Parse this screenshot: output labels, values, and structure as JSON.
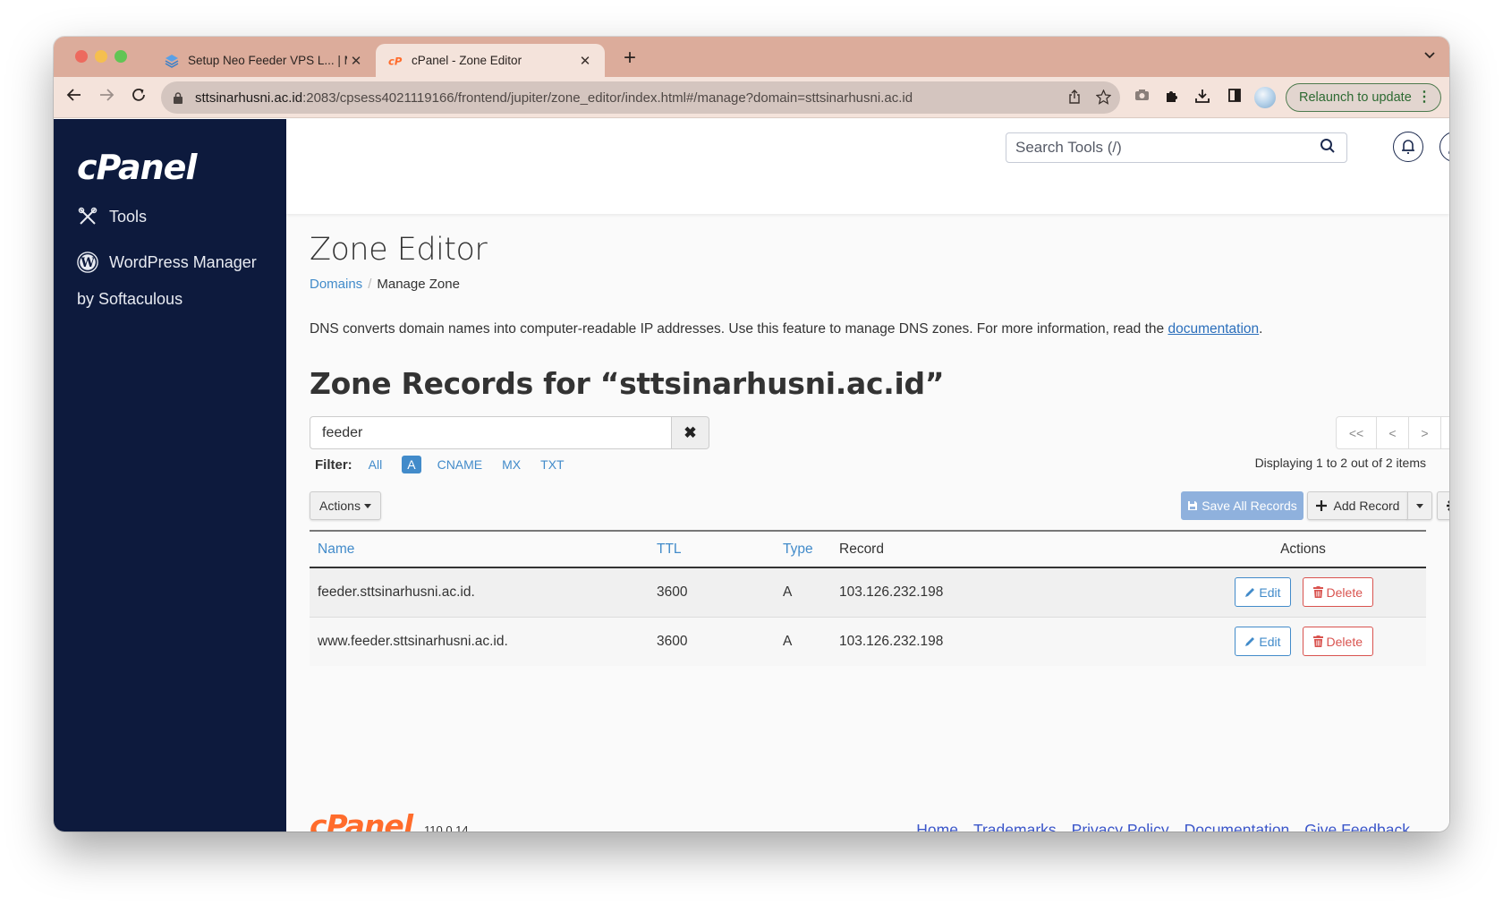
{
  "browser": {
    "tabs": [
      {
        "title": "Setup Neo Feeder VPS L... | M",
        "favicon": "stack-icon",
        "active": false
      },
      {
        "title": "cPanel - Zone Editor",
        "favicon": "cpanel-icon",
        "active": true
      }
    ],
    "new_tab_label": "+",
    "tab_close_glyph": "✕",
    "address": {
      "host": "sttsinarhusni.ac.id",
      "path": ":2083/cpsess4021119166/frontend/jupiter/zone_editor/index.html#/manage?domain=sttsinarhusni.ac.id"
    },
    "relaunch_label": "Relaunch to update"
  },
  "sidebar": {
    "logo": "cPanel",
    "items": [
      {
        "label": "Tools",
        "icon": "tools-icon"
      },
      {
        "label": "WordPress Manager",
        "sublabel": "by Softaculous",
        "icon": "wordpress-icon"
      }
    ]
  },
  "header": {
    "search_placeholder": "Search Tools (/)"
  },
  "page": {
    "title": "Zone Editor",
    "breadcrumb": [
      {
        "label": "Domains",
        "link": true
      },
      {
        "label": "Manage Zone",
        "link": false
      }
    ],
    "intro_text": "DNS converts domain names into computer-readable IP addresses. Use this feature to manage DNS zones. For more information, read the ",
    "intro_link": "documentation",
    "intro_end": ".",
    "zone_title": "Zone Records for “sttsinarhusni.ac.id”"
  },
  "records_search": {
    "value": "feeder",
    "clear_glyph": "✖"
  },
  "filter": {
    "label": "Filter:",
    "options": [
      {
        "label": "All",
        "active": false
      },
      {
        "label": "A",
        "active": true
      },
      {
        "label": "CNAME",
        "active": false
      },
      {
        "label": "MX",
        "active": false
      },
      {
        "label": "TXT",
        "active": false
      }
    ]
  },
  "pagination": {
    "first": "<<",
    "prev": "<",
    "next": ">",
    "last": ">>",
    "summary": "Displaying 1 to 2 out of 2 items"
  },
  "toolbar": {
    "actions_label": "Actions",
    "save_all_label": "Save All Records",
    "add_record_label": "Add Record"
  },
  "table": {
    "columns": [
      "Name",
      "TTL",
      "Type",
      "Record",
      "Actions"
    ],
    "rows": [
      {
        "name": "feeder.sttsinarhusni.ac.id.",
        "ttl": "3600",
        "type": "A",
        "record": "103.126.232.198"
      },
      {
        "name": "www.feeder.sttsinarhusni.ac.id.",
        "ttl": "3600",
        "type": "A",
        "record": "103.126.232.198"
      }
    ],
    "edit_label": "Edit",
    "delete_label": "Delete"
  },
  "footer": {
    "logo": "cPanel",
    "version": "110.0.14",
    "links": [
      "Home",
      "Trademarks",
      "Privacy Policy",
      "Documentation",
      "Give Feedback"
    ]
  },
  "colors": {
    "sidebar_bg": "#0d1a3d",
    "link": "#428bca",
    "danger": "#d9534f",
    "brand_orange": "#ff6c2c",
    "tabstrip": "#dcac9b"
  }
}
